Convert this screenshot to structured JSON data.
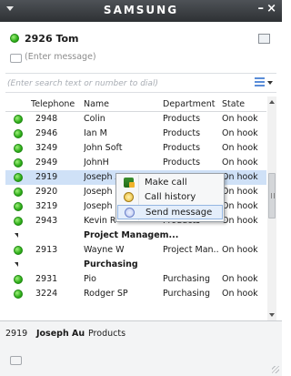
{
  "window": {
    "title": "SAMSUNG",
    "minimize": "–",
    "close": "×"
  },
  "user": {
    "number_name": "2926 Tom",
    "message_placeholder": "(Enter message)",
    "status_color": "#2fae1a"
  },
  "search": {
    "placeholder": "(Enter search text or number to dial)"
  },
  "columns": {
    "telephone": "Telephone",
    "name": "Name",
    "department": "Department",
    "state": "State"
  },
  "contacts": [
    {
      "type": "contact",
      "telephone": "2948",
      "name": "Colin",
      "department": "Products",
      "state": "On hook"
    },
    {
      "type": "contact",
      "telephone": "2946",
      "name": "Ian M",
      "department": "Products",
      "state": "On hook"
    },
    {
      "type": "contact",
      "telephone": "3249",
      "name": "John Soft",
      "department": "Products",
      "state": "On hook"
    },
    {
      "type": "contact",
      "telephone": "2949",
      "name": "JohnH",
      "department": "Products",
      "state": "On hook"
    },
    {
      "type": "contact",
      "telephone": "2919",
      "name": "Joseph A",
      "department": "",
      "state": "On hook",
      "selected": true
    },
    {
      "type": "contact",
      "telephone": "2920",
      "name": "Joseph P",
      "department": "",
      "state": "On hook"
    },
    {
      "type": "contact",
      "telephone": "3219",
      "name": "Joseph S",
      "department": "",
      "state": "On hook"
    },
    {
      "type": "contact",
      "telephone": "2943",
      "name": "Kevin R",
      "department": "Products",
      "state": "On hook"
    },
    {
      "type": "group",
      "label": "Project Managem..."
    },
    {
      "type": "contact",
      "telephone": "2913",
      "name": "Wayne W",
      "department": "Project Man...",
      "state": "On hook"
    },
    {
      "type": "group",
      "label": "Purchasing"
    },
    {
      "type": "contact",
      "telephone": "2931",
      "name": "Pio",
      "department": "Purchasing",
      "state": "On hook"
    },
    {
      "type": "contact",
      "telephone": "3224",
      "name": "Rodger SP",
      "department": "Purchasing",
      "state": "On hook"
    }
  ],
  "context_menu": {
    "items": [
      {
        "label": "Make call",
        "icon": "phone-call-icon"
      },
      {
        "label": "Call history",
        "icon": "call-history-icon"
      },
      {
        "label": "Send message",
        "icon": "send-message-icon",
        "highlighted": true
      }
    ]
  },
  "footer": {
    "number": "2919",
    "name": "Joseph Au",
    "department": "Products"
  }
}
